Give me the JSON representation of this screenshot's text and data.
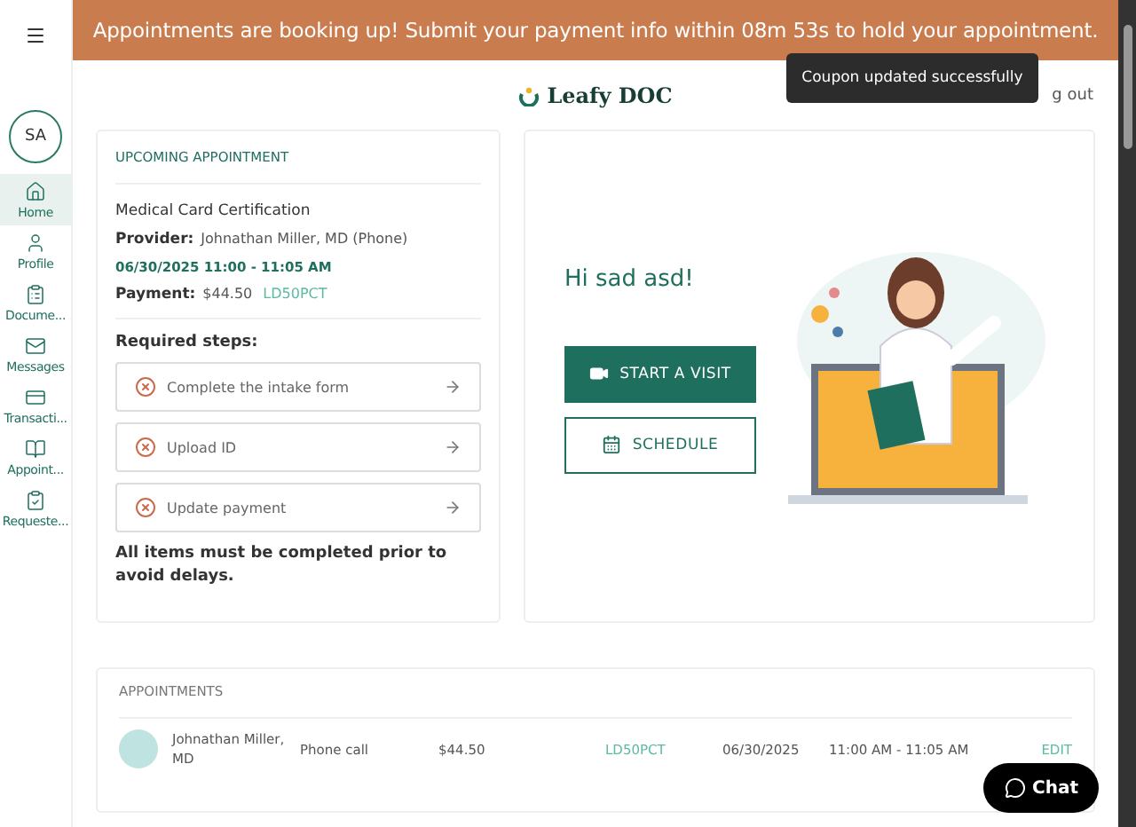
{
  "banner": {
    "text": "Appointments are booking up! Submit your payment info within 08m 53s to hold your appointment."
  },
  "sidebar": {
    "avatar": "SA",
    "items": [
      {
        "kind": "home",
        "label": "Home",
        "selected": true
      },
      {
        "kind": "profile",
        "label": "Profile",
        "selected": false
      },
      {
        "kind": "documents",
        "label": "Docume...",
        "selected": false
      },
      {
        "kind": "messages",
        "label": "Messages",
        "selected": false
      },
      {
        "kind": "transactions",
        "label": "Transacti...",
        "selected": false
      },
      {
        "kind": "appointments",
        "label": "Appoint...",
        "selected": false
      },
      {
        "kind": "requests",
        "label": "Requeste...",
        "selected": false
      }
    ]
  },
  "header": {
    "logo": "Leafy DOC",
    "logout": "g out"
  },
  "toast": {
    "text": "Coupon updated successfully"
  },
  "upcoming": {
    "title": "UPCOMING APPOINTMENT",
    "service": "Medical Card Certification",
    "provider_label": "Provider:",
    "provider": "Johnathan Miller, MD (Phone)",
    "datetime": "06/30/2025 11:00 - 11:05 AM",
    "payment_label": "Payment:",
    "payment": "$44.50",
    "coupon": "LD50PCT",
    "steps_title": "Required steps:",
    "steps": [
      {
        "label": "Complete the intake form",
        "done": false
      },
      {
        "label": "Upload ID",
        "done": false
      },
      {
        "label": "Update payment",
        "done": false
      }
    ],
    "note": "All items must be completed prior to avoid delays."
  },
  "welcome": {
    "greeting": "Hi sad asd!",
    "start_button": "START A VISIT",
    "schedule_button": "SCHEDULE"
  },
  "appointments": {
    "title": "APPOINTMENTS",
    "rows": [
      {
        "provider": "Johnathan Miller, MD",
        "type": "Phone call",
        "price": "$44.50",
        "coupon": "LD50PCT",
        "date": "06/30/2025",
        "time": "11:00 AM - 11:05 AM",
        "action": "EDIT"
      }
    ]
  },
  "chat": {
    "label": "Chat"
  }
}
